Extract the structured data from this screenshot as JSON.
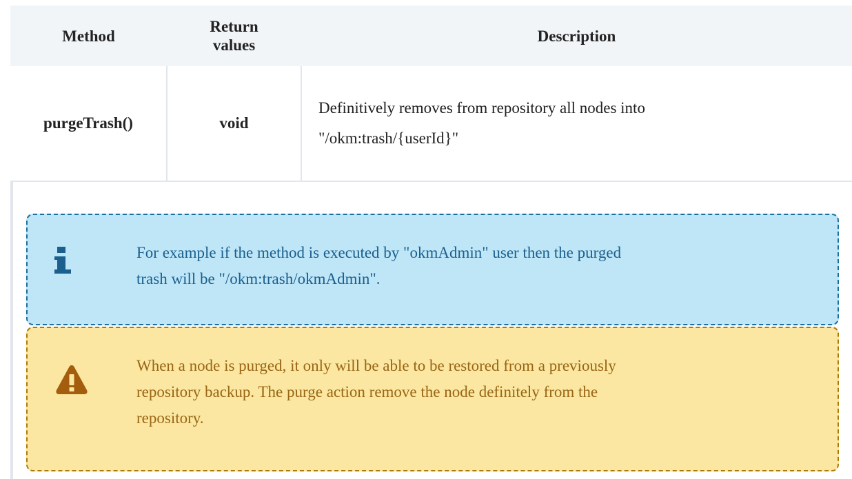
{
  "table": {
    "headers": {
      "method": "Method",
      "return_values": "Return values",
      "description": "Description"
    },
    "rows": [
      {
        "method": "purgeTrash()",
        "return_values": "void",
        "description_line1": "Definitively removes from repository all nodes into",
        "description_line2": "\"/okm:trash/{userId}\""
      }
    ]
  },
  "callouts": {
    "info": {
      "icon": "info-icon",
      "line1": "For example if the method is executed by \"okmAdmin\" user then the purged",
      "line2": "trash will be \"/okm:trash/okmAdmin\"."
    },
    "warning": {
      "icon": "warning-icon",
      "line1": "When a node is purged, it only will be able to be restored from a previously",
      "line2": "repository backup. The purge action remove the node definitely from the",
      "line3": "repository."
    }
  },
  "colors": {
    "info_background": "#bfe6f7",
    "info_border": "#1a6fa0",
    "info_text": "#1a5f8e",
    "warning_background": "#fbe7a1",
    "warning_border": "#ad7a0a",
    "warning_text": "#996615",
    "warning_icon": "#a35d0c",
    "table_header_background": "#f2f5f8"
  }
}
